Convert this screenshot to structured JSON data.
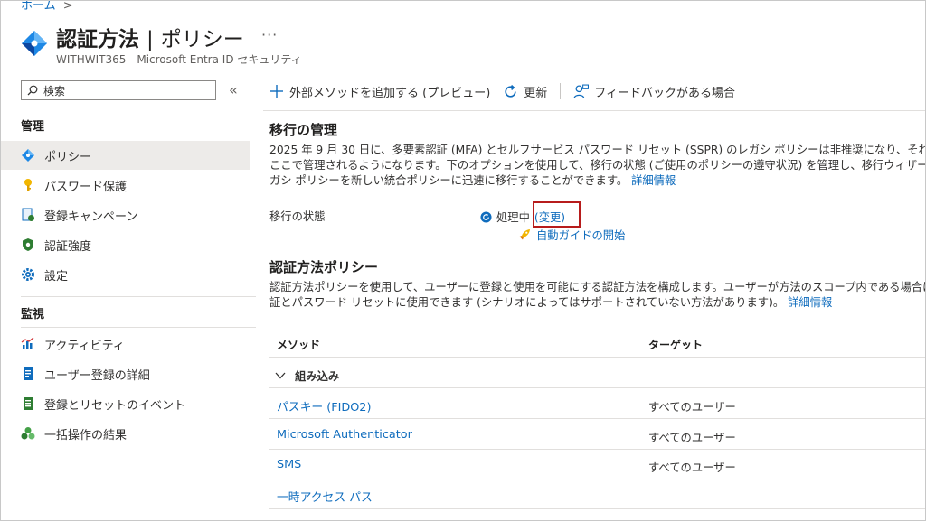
{
  "breadcrumb": {
    "home": "ホーム",
    "chevron": ">"
  },
  "header": {
    "title": "認証方法",
    "separator": "|",
    "subtitle_title": "ポリシー",
    "more": "···",
    "subtitle": "WITHWIT365 - Microsoft Entra ID セキュリティ"
  },
  "sidebar": {
    "search_placeholder": "検索",
    "collapse": "«",
    "sections": [
      {
        "label": "管理",
        "items": [
          {
            "label": "ポリシー",
            "icon": "policy-icon",
            "active": true
          },
          {
            "label": "パスワード保護",
            "icon": "key-icon"
          },
          {
            "label": "登録キャンペーン",
            "icon": "campaign-icon"
          },
          {
            "label": "認証強度",
            "icon": "shield-icon"
          },
          {
            "label": "設定",
            "icon": "gear-icon"
          }
        ]
      },
      {
        "label": "監視",
        "items": [
          {
            "label": "アクティビティ",
            "icon": "activity-chart-icon"
          },
          {
            "label": "ユーザー登録の詳細",
            "icon": "user-details-icon"
          },
          {
            "label": "登録とリセットのイベント",
            "icon": "events-icon"
          },
          {
            "label": "一括操作の結果",
            "icon": "bulk-ops-icon"
          }
        ]
      }
    ]
  },
  "toolbar": {
    "add_external": "外部メソッドを追加する (プレビュー)",
    "refresh": "更新",
    "feedback": "フィードバックがある場合"
  },
  "migration": {
    "heading": "移行の管理",
    "lines": [
      "2025 年 9 月 30 日に、多要素認証 (MFA) とセルフサービス パスワード リセット (SSPR) のレガシ ポリシーは非推奨になり、それらの設",
      "ここで管理されるようになります。下のオプションを使用して、移行の状態 (ご使用のポリシーの遵守状況) を管理し、移行ウィザードを利用し",
      "ガシ ポリシーを新しい統合ポリシーに迅速に移行することができます。"
    ],
    "learn_more": "詳細情報",
    "state_label": "移行の状態",
    "state_value": "処理中",
    "change_link": "(変更)",
    "guide_link": "自動ガイドの開始"
  },
  "policy": {
    "heading": "認証方法ポリシー",
    "lines": [
      "認証方法ポリシーを使用して、ユーザーに登録と使用を可能にする認証方法を構成します。ユーザーが方法のスコープ内である場合は、それ",
      "証とパスワード リセットに使用できます (シナリオによってはサポートされていない方法があります)。"
    ],
    "learn_more": "詳細情報"
  },
  "table": {
    "col_method": "メソッド",
    "col_target": "ターゲット",
    "group": "組み込み",
    "rows": [
      {
        "name": "パスキー (FIDO2)",
        "target": "すべてのユーザー"
      },
      {
        "name": "Microsoft Authenticator",
        "target": "すべてのユーザー"
      },
      {
        "name": "SMS",
        "target": "すべてのユーザー"
      },
      {
        "name": "一時アクセス パス",
        "target": ""
      }
    ]
  },
  "colors": {
    "link": "#0f6cbd",
    "highlight": "#b71c1c",
    "active_bg": "#edebe9"
  }
}
